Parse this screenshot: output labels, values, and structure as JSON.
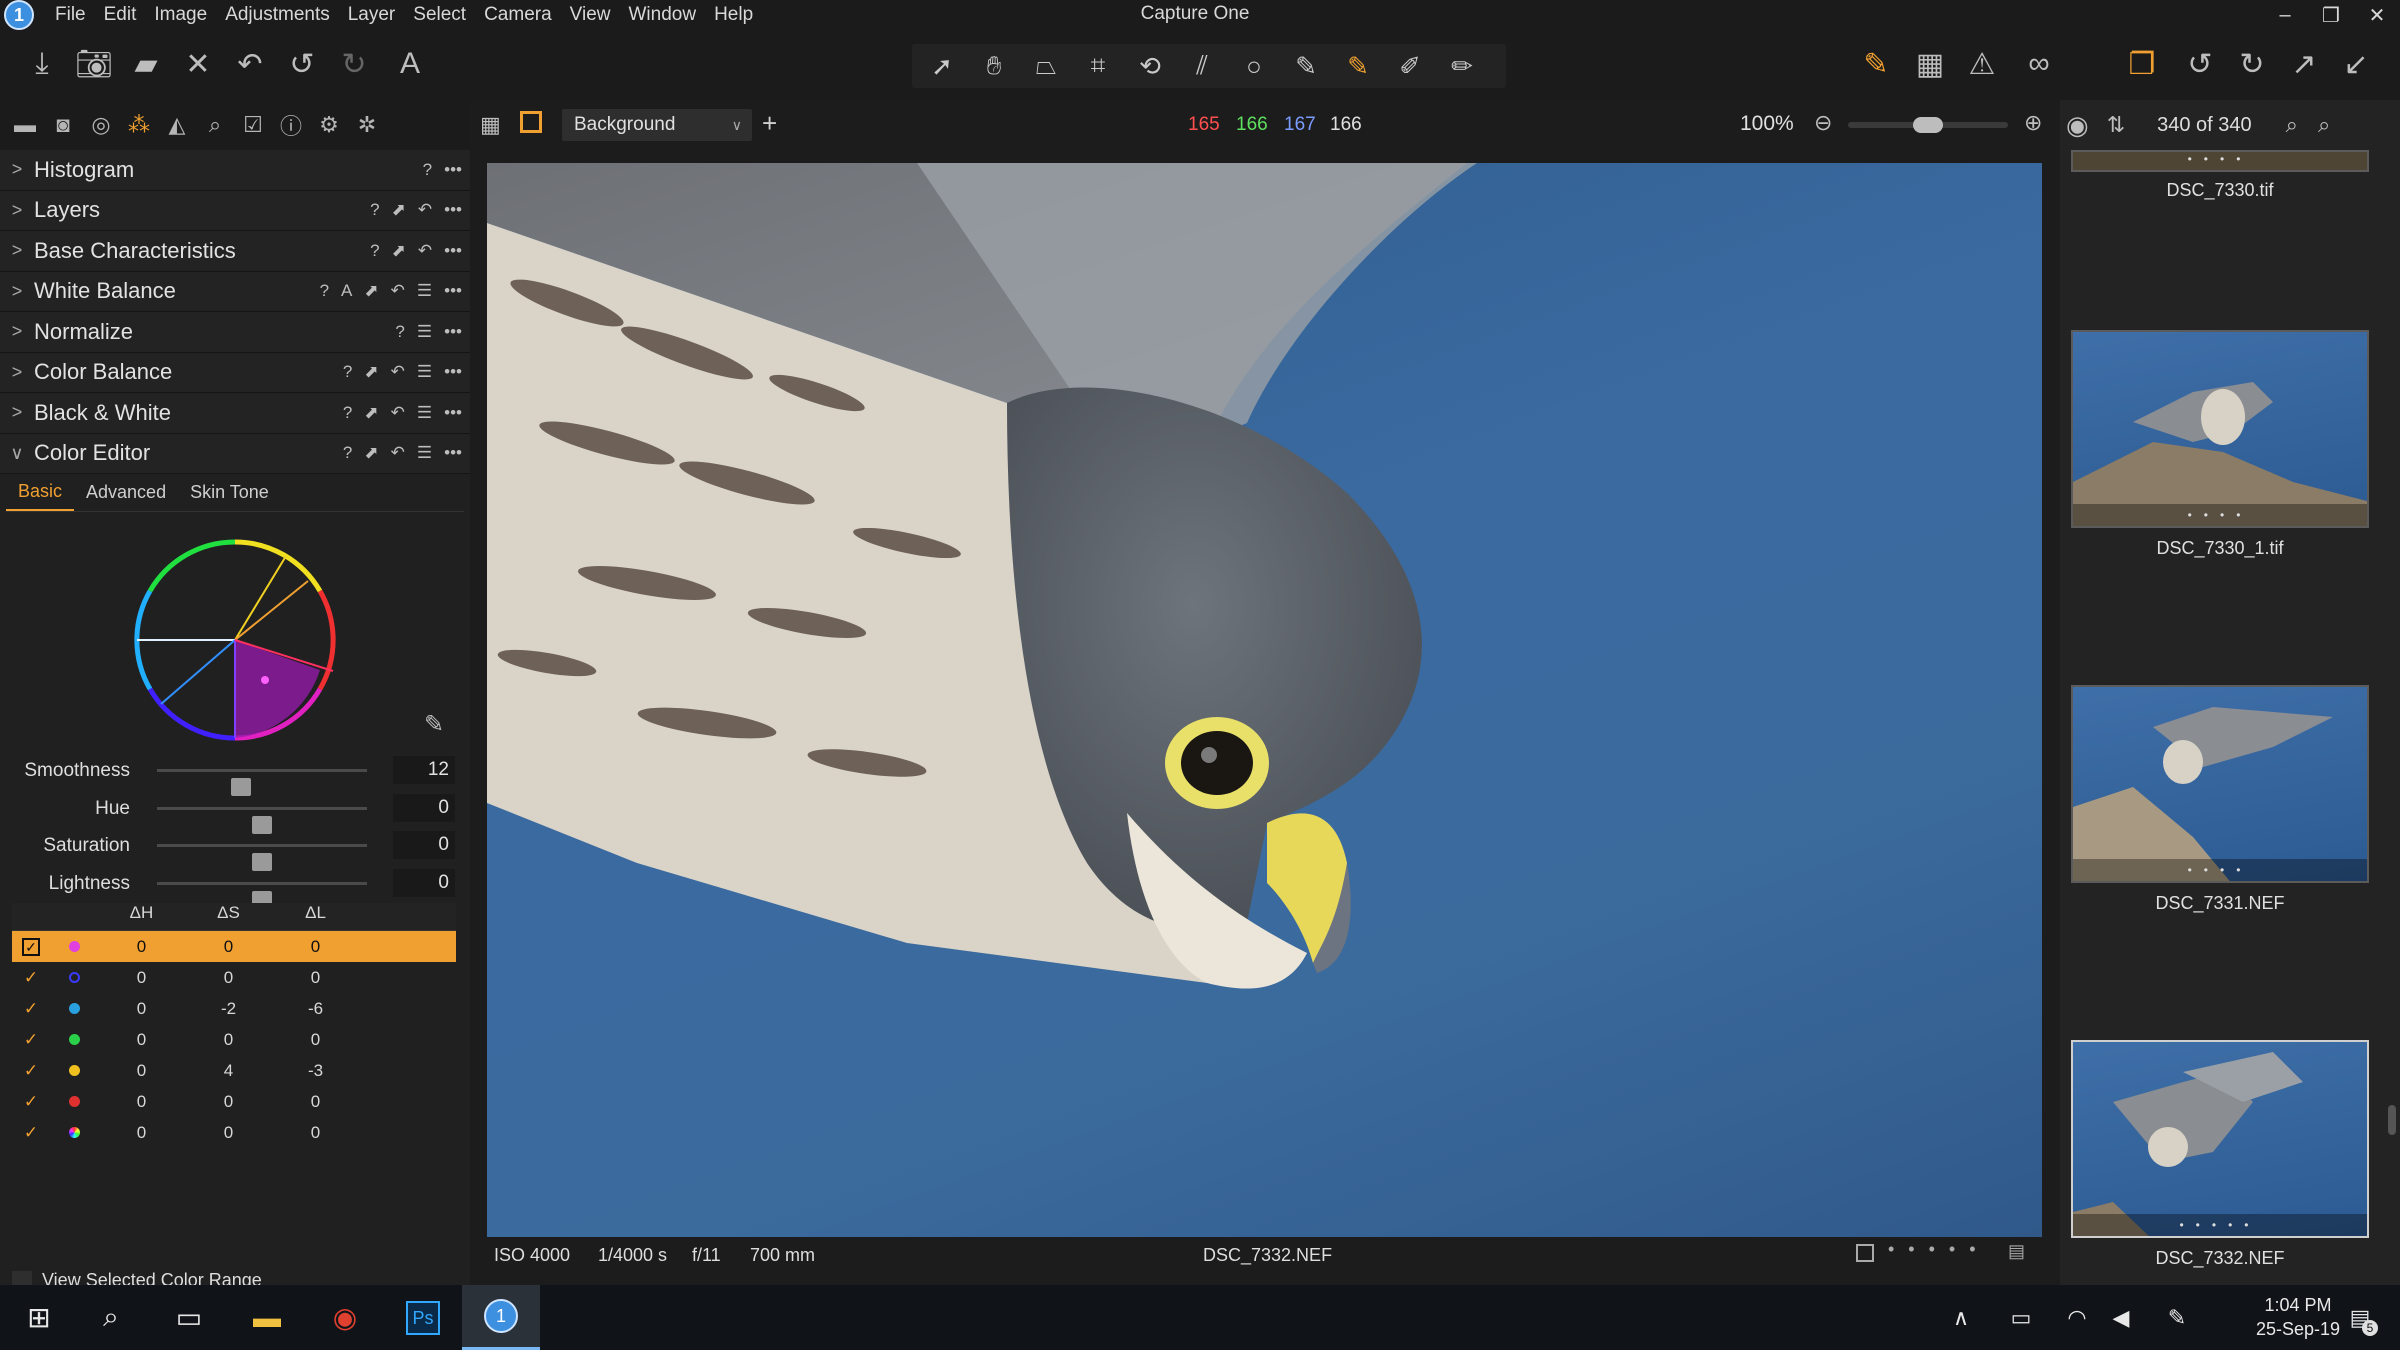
{
  "app": {
    "title": "Capture One",
    "menus": [
      "File",
      "Edit",
      "Image",
      "Adjustments",
      "Layer",
      "Select",
      "Camera",
      "View",
      "Window",
      "Help"
    ],
    "logo_text": "1"
  },
  "window_controls": {
    "minimize": "–",
    "restore": "❐",
    "close": "✕"
  },
  "left_panel": {
    "tools": [
      {
        "label": "Histogram",
        "expanded": false
      },
      {
        "label": "Layers",
        "expanded": false
      },
      {
        "label": "Base Characteristics",
        "expanded": false
      },
      {
        "label": "White Balance",
        "expanded": false
      },
      {
        "label": "Normalize",
        "expanded": false
      },
      {
        "label": "Color Balance",
        "expanded": false
      },
      {
        "label": "Black & White",
        "expanded": false
      },
      {
        "label": "Color Editor",
        "expanded": true
      }
    ],
    "color_editor": {
      "tabs": [
        "Basic",
        "Advanced",
        "Skin Tone"
      ],
      "active_tab": "Basic",
      "sliders": [
        {
          "label": "Smoothness",
          "value": "12",
          "position": 0.4
        },
        {
          "label": "Hue",
          "value": "0",
          "position": 0.5
        },
        {
          "label": "Saturation",
          "value": "0",
          "position": 0.5
        },
        {
          "label": "Lightness",
          "value": "0",
          "position": 0.5
        }
      ],
      "table_headers": [
        "ΔH",
        "ΔS",
        "ΔL"
      ],
      "rows": [
        {
          "color": "#e040e0",
          "dh": "0",
          "ds": "0",
          "dl": "0",
          "selected": true
        },
        {
          "color": "#3a3aff",
          "dh": "0",
          "ds": "0",
          "dl": "0",
          "selected": false
        },
        {
          "color": "#2aa0e0",
          "dh": "0",
          "ds": "-2",
          "dl": "-6",
          "selected": false
        },
        {
          "color": "#2ad04a",
          "dh": "0",
          "ds": "0",
          "dl": "0",
          "selected": false
        },
        {
          "color": "#f0c020",
          "dh": "0",
          "ds": "4",
          "dl": "-3",
          "selected": false
        },
        {
          "color": "#e03030",
          "dh": "0",
          "ds": "0",
          "dl": "0",
          "selected": false
        },
        {
          "color": "#c0c0ff",
          "dh": "0",
          "ds": "0",
          "dl": "0",
          "selected": false
        }
      ],
      "view_selected_label": "View Selected Color Range"
    }
  },
  "viewer": {
    "layer_select": "Background",
    "rgb_readout": {
      "r": "165",
      "g": "166",
      "b": "167",
      "l": "166"
    },
    "zoom": "100%",
    "zoom_level": 0.5,
    "count": "340 of 340"
  },
  "info_bar": {
    "iso": "ISO 4000",
    "shutter": "1/4000 s",
    "aperture": "f/11",
    "focal": "700 mm",
    "filename": "DSC_7332.NEF"
  },
  "browser": {
    "thumbnails": [
      {
        "name": "DSC_7330.tif",
        "selected": false
      },
      {
        "name": "DSC_7330_1.tif",
        "selected": false
      },
      {
        "name": "DSC_7331.NEF",
        "selected": false
      },
      {
        "name": "DSC_7332.NEF",
        "selected": true
      }
    ]
  },
  "taskbar": {
    "time": "1:04 PM",
    "date": "25-Sep-19",
    "notifications": "5"
  },
  "colors": {
    "accent": "#f0a030",
    "red": "#ff5050",
    "green": "#5ee05e",
    "blue": "#7a9cff"
  }
}
